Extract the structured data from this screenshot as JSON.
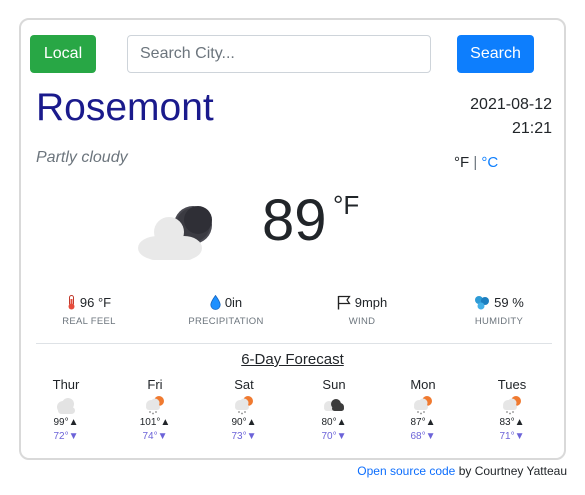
{
  "header": {
    "local_label": "Local",
    "search_placeholder": "Search City...",
    "search_label": "Search"
  },
  "current": {
    "city": "Rosemont",
    "date": "2021-08-12",
    "time": "21:21",
    "condition": "Partly cloudy",
    "unit_f": "°F",
    "unit_sep": "|",
    "unit_c": "°C",
    "temp": "89",
    "temp_unit": "°F",
    "icon": "partly-cloudy-night-icon"
  },
  "stats": [
    {
      "icon": "thermometer-icon",
      "value": "96 °F",
      "label": "REAL FEEL"
    },
    {
      "icon": "water-drop-icon",
      "value": "0in",
      "label": "PRECIPITATION"
    },
    {
      "icon": "flag-icon",
      "value": "9mph",
      "label": "WIND"
    },
    {
      "icon": "humidity-icon",
      "value": "59 %",
      "label": "HUMIDITY"
    }
  ],
  "forecast": {
    "title": "6-Day Forecast",
    "days": [
      {
        "name": "Thur",
        "icon": "cloudy-icon",
        "high": "99°▲",
        "low": "72°▼"
      },
      {
        "name": "Fri",
        "icon": "sun-rain-icon",
        "high": "101°▲",
        "low": "74°▼"
      },
      {
        "name": "Sat",
        "icon": "sun-rain-icon",
        "high": "90°▲",
        "low": "73°▼"
      },
      {
        "name": "Sun",
        "icon": "storm-cloud-icon",
        "high": "80°▲",
        "low": "70°▼"
      },
      {
        "name": "Mon",
        "icon": "sun-rain-icon",
        "high": "87°▲",
        "low": "68°▼"
      },
      {
        "name": "Tues",
        "icon": "sun-rain-icon",
        "high": "83°▲",
        "low": "71°▼"
      }
    ]
  },
  "footer": {
    "link_text": "Open source code",
    "suffix": " by Courtney Yatteau"
  },
  "colors": {
    "local_button": "#28a745",
    "search_button": "#0d7efd",
    "city_text": "#1a1a8c",
    "low_temp": "#6c63d8"
  }
}
